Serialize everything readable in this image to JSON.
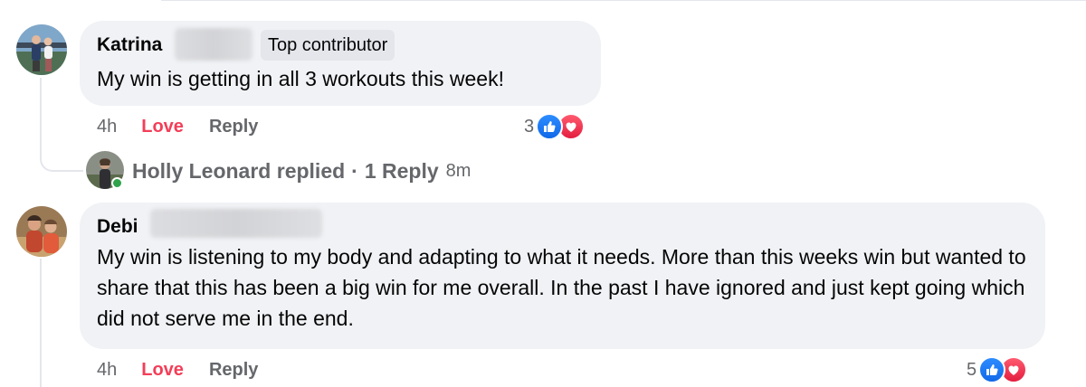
{
  "comments": [
    {
      "author": "Katrina",
      "badge": "Top contributor",
      "text": "My win is getting in all 3 workouts this week!",
      "time": "4h",
      "love_label": "Love",
      "reply_label": "Reply",
      "reaction_count": "3",
      "reactions": [
        "like-icon",
        "heart-icon"
      ]
    },
    {
      "author": "Debi",
      "text": "My win is listening to my body and adapting to what it needs. More than this weeks win but wanted to share that this has been a big win for me overall. In the past I have ignored and just kept going which did not serve me in the end.",
      "time": "4h",
      "love_label": "Love",
      "reply_label": "Reply",
      "reaction_count": "5",
      "reactions": [
        "like-icon",
        "heart-icon"
      ]
    }
  ],
  "reply_summary": {
    "name_text": "Holly Leonard replied",
    "separator": "·",
    "count_text": "1 Reply",
    "time": "8m"
  },
  "colors": {
    "bubble": "#f0f2f5",
    "love": "#f33e58",
    "muted": "#65676b",
    "like": "#1877f2",
    "online": "#31a24c"
  }
}
